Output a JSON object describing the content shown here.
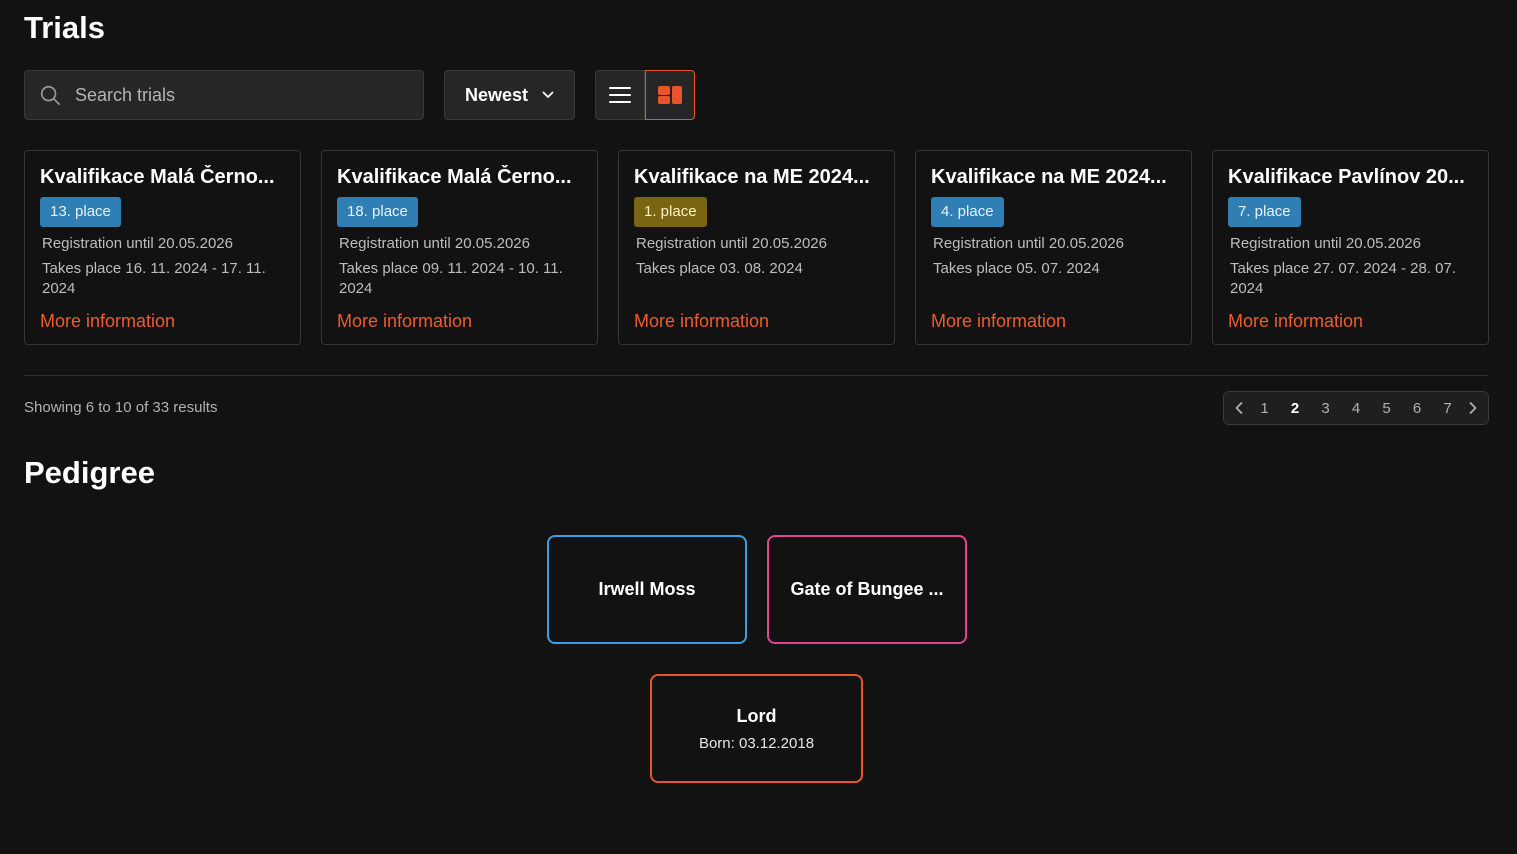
{
  "page": {
    "title": "Trials"
  },
  "toolbar": {
    "search_placeholder": "Search trials",
    "search_value": "",
    "sort_value": "Newest",
    "view_modes": [
      "list",
      "grid"
    ],
    "active_view": "grid"
  },
  "trials": [
    {
      "title": "Kvalifikace Malá Černo...",
      "place": "13. place",
      "badge_color": "#2f7fb4",
      "registration": "Registration until 20.05.2026",
      "takes_place": "Takes place 16. 11. 2024 - 17. 11. 2024",
      "link": "More information"
    },
    {
      "title": "Kvalifikace Malá Černo...",
      "place": "18. place",
      "badge_color": "#2f7fb4",
      "registration": "Registration until 20.05.2026",
      "takes_place": "Takes place 09. 11. 2024 - 10. 11. 2024",
      "link": "More information"
    },
    {
      "title": "Kvalifikace na ME 2024...",
      "place": "1. place",
      "badge_color": "#7a6514",
      "registration": "Registration until 20.05.2026",
      "takes_place": "Takes place 03. 08. 2024",
      "link": "More information"
    },
    {
      "title": "Kvalifikace na ME 2024...",
      "place": "4. place",
      "badge_color": "#2f7fb4",
      "registration": "Registration until 20.05.2026",
      "takes_place": "Takes place 05. 07. 2024",
      "link": "More information"
    },
    {
      "title": "Kvalifikace Pavlínov 20...",
      "place": "7. place",
      "badge_color": "#2f7fb4",
      "registration": "Registration until 20.05.2026",
      "takes_place": "Takes place 27. 07. 2024 - 28. 07. 2024",
      "link": "More information"
    }
  ],
  "results": {
    "text": "Showing 6 to 10 of 33 results"
  },
  "pagination": {
    "pages": [
      "1",
      "2",
      "3",
      "4",
      "5",
      "6",
      "7"
    ],
    "current": "2"
  },
  "pedigree": {
    "title": "Pedigree",
    "sire": {
      "name": "Irwell Moss",
      "color": "#3a9ee3"
    },
    "dam": {
      "name": "Gate of Bungee ...",
      "color": "#e0448e"
    },
    "dog": {
      "name": "Lord",
      "born": "Born: 03.12.2018",
      "color": "#e8552b"
    }
  },
  "colors": {
    "accent": "#e8552b",
    "link": "#ef5a2e",
    "background": "#121212"
  }
}
